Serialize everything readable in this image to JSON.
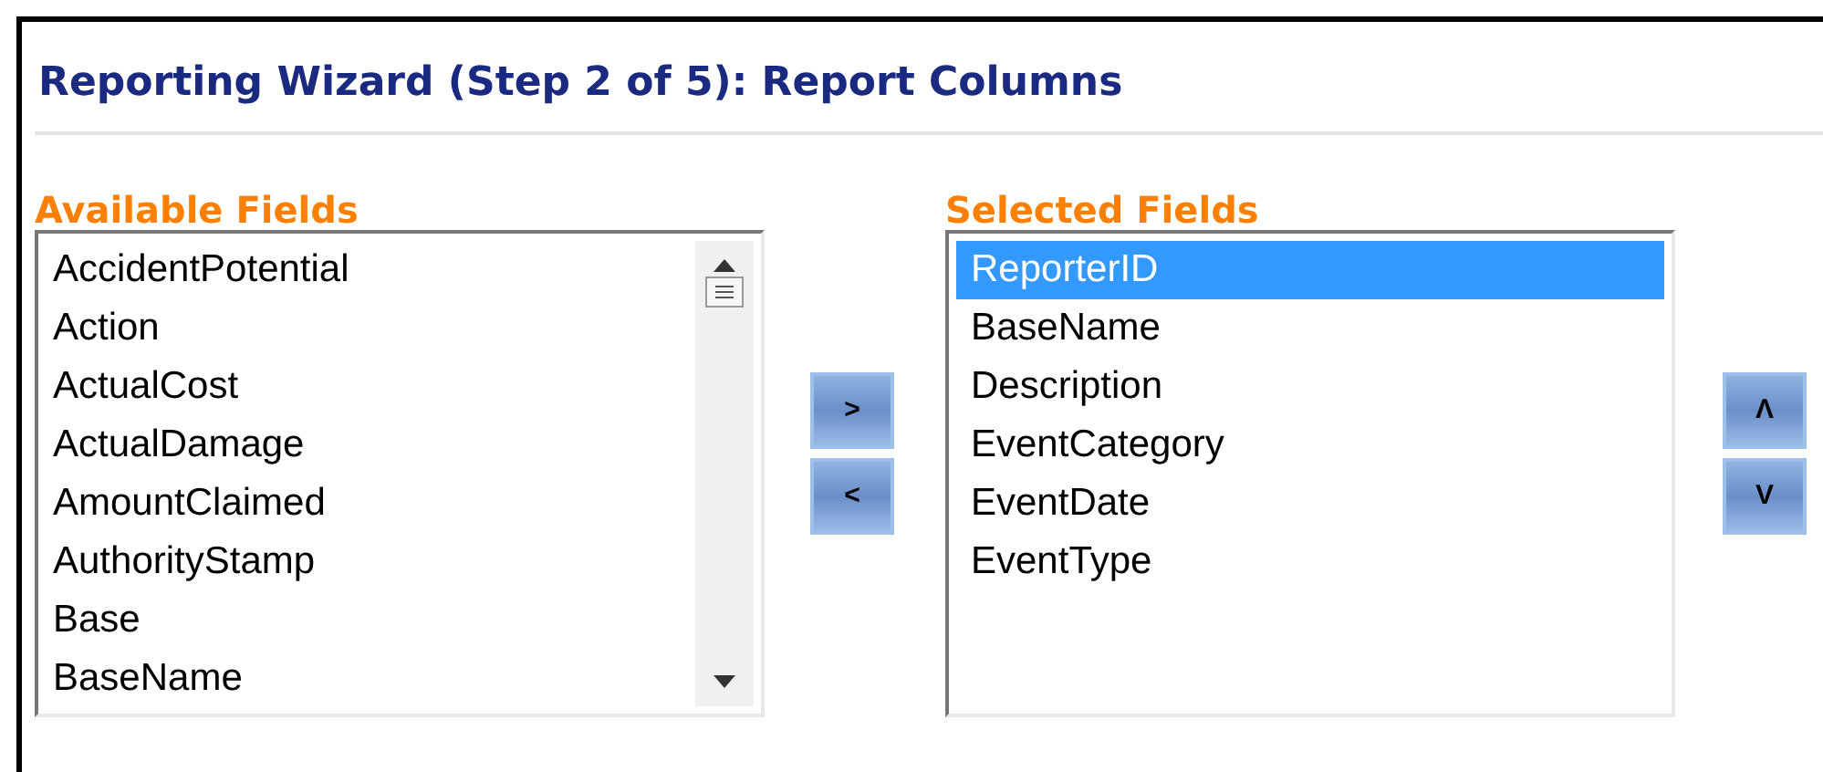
{
  "title": "Reporting Wizard (Step 2 of 5): Report Columns",
  "available": {
    "label": "Available Fields",
    "items": [
      {
        "text": "AccidentPotential",
        "selected": false
      },
      {
        "text": "Action",
        "selected": false
      },
      {
        "text": "ActualCost",
        "selected": false
      },
      {
        "text": "ActualDamage",
        "selected": false
      },
      {
        "text": "AmountClaimed",
        "selected": false
      },
      {
        "text": "AuthorityStamp",
        "selected": false
      },
      {
        "text": "Base",
        "selected": false
      },
      {
        "text": "BaseName",
        "selected": false
      }
    ]
  },
  "move_buttons": [
    ">",
    "<"
  ],
  "selected": {
    "label": "Selected Fields",
    "items": [
      {
        "text": "ReporterID",
        "selected": true
      },
      {
        "text": "BaseName",
        "selected": false
      },
      {
        "text": "Description",
        "selected": false
      },
      {
        "text": "EventCategory",
        "selected": false
      },
      {
        "text": "EventDate",
        "selected": false
      },
      {
        "text": "EventType",
        "selected": false
      }
    ]
  },
  "order_buttons": [
    "Λ",
    "V"
  ]
}
